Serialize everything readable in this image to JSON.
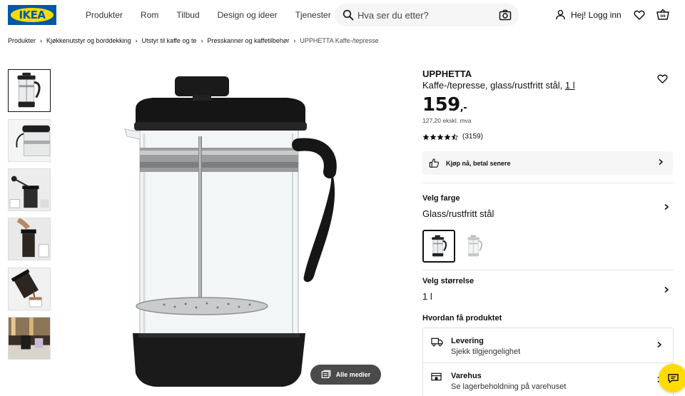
{
  "brand": {
    "logo_text": "IKEA",
    "colors": {
      "blue": "#0058a3",
      "yellow": "#ffdb00"
    }
  },
  "nav": {
    "items": [
      "Produkter",
      "Rom",
      "Tilbud",
      "Design og ideer",
      "Tjenester"
    ]
  },
  "search": {
    "placeholder": "Hva ser du etter?",
    "value": "",
    "icon": "search-icon",
    "camera_icon": "camera-icon"
  },
  "account": {
    "login_label": "Hej! Logg inn",
    "icons": [
      "user-icon",
      "heart-icon",
      "basket-icon"
    ]
  },
  "breadcrumb": {
    "items": [
      "Produkter",
      "Kjøkkenutstyr og borddekking",
      "Utstyr til kaffe og te",
      "Presskanner og kaffetilbehør"
    ],
    "current": "UPPHETTA Kaffe-/tepresse"
  },
  "gallery": {
    "thumbnails": [
      "product-front",
      "product-lid-detail",
      "product-scene-spoon",
      "product-scene-pressing",
      "product-scene-pouring",
      "product-scene-kitchen"
    ],
    "all_media_label": "Alle medier"
  },
  "product": {
    "name": "UPPHETTA",
    "description": "Kaffe-/tepresse, glass/rustfritt stål,",
    "size_link": "1 l",
    "price_main": "159",
    "price_suffix": ",-",
    "price_ex_vat": "127,20 ekskl. mva",
    "rating": {
      "stars": 4.5,
      "count": "(3159)"
    },
    "bnpl_label": "Kjøp nå, betal senere",
    "color_label": "Velg farge",
    "color_value": "Glass/rustfritt stål",
    "size_label": "Velg størrelse",
    "size_value": "1 l",
    "delivery_heading": "Hvordan få produktet",
    "delivery": {
      "title": "Levering",
      "subtitle": "Sjekk tilgjengelighet"
    },
    "store": {
      "title": "Varehus",
      "subtitle": "Se lagerbeholdning på varehuset"
    }
  }
}
